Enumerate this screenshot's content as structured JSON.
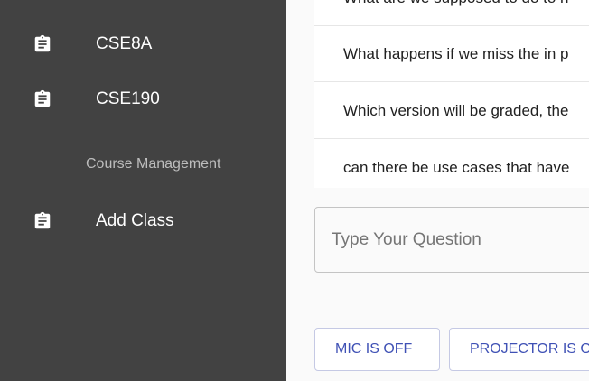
{
  "sidebar": {
    "items": [
      {
        "label": "CSE8A",
        "icon": "clipboard-icon"
      },
      {
        "label": "CSE190",
        "icon": "clipboard-icon"
      }
    ],
    "section_header": "Course Management",
    "management_items": [
      {
        "label": "Add Class",
        "icon": "clipboard-icon"
      }
    ]
  },
  "questions": [
    "What are we supposed to do to n",
    "What happens if we miss the in p",
    "Which version will be graded, the",
    "can there be use cases that have"
  ],
  "question_input": {
    "placeholder": "Type Your Question",
    "value": ""
  },
  "controls": {
    "mic_label": "MIC IS OFF",
    "projector_label": "PROJECTOR IS O"
  },
  "colors": {
    "sidebar_bg": "#424242",
    "accent": "#3f51b5",
    "content_bg": "#fafafa"
  }
}
